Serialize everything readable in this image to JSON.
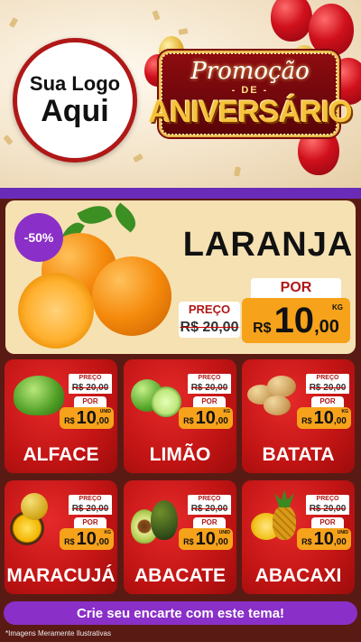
{
  "header": {
    "logo_line1": "Sua Logo",
    "logo_line2": "Aqui",
    "promo_line1": "Promoção",
    "promo_line2": "- DE -",
    "promo_line3": "ANIVERSÁRIO"
  },
  "colors": {
    "accent_purple": "#8a2fc7",
    "card_red": "#c21414",
    "price_orange": "#f7a21b",
    "bg_brown": "#5a1a14"
  },
  "hero": {
    "discount": "-50%",
    "name": "LARANJA",
    "preco_label": "PREÇO",
    "old_price": "R$ 20,00",
    "por_label": "POR",
    "currency": "R$",
    "price_int": "10",
    "price_cents": ",00",
    "unit": "KG"
  },
  "products": [
    {
      "name": "ALFACE",
      "preco_label": "PREÇO",
      "old_price": "R$ 20,00",
      "por_label": "POR",
      "currency": "R$",
      "price_int": "10",
      "price_cents": ",00",
      "unit": "UNID",
      "icon": "lettuce-icon"
    },
    {
      "name": "LIMÃO",
      "preco_label": "PREÇO",
      "old_price": "R$ 20,00",
      "por_label": "POR",
      "currency": "R$",
      "price_int": "10",
      "price_cents": ",00",
      "unit": "KG",
      "icon": "lime-icon"
    },
    {
      "name": "BATATA",
      "preco_label": "PREÇO",
      "old_price": "R$ 20,00",
      "por_label": "POR",
      "currency": "R$",
      "price_int": "10",
      "price_cents": ",00",
      "unit": "KG",
      "icon": "potato-icon"
    },
    {
      "name": "MARACUJÁ",
      "preco_label": "PREÇO",
      "old_price": "R$ 20,00",
      "por_label": "POR",
      "currency": "R$",
      "price_int": "10",
      "price_cents": ",00",
      "unit": "KG",
      "icon": "passion-fruit-icon"
    },
    {
      "name": "ABACATE",
      "preco_label": "PREÇO",
      "old_price": "R$ 20,00",
      "por_label": "POR",
      "currency": "R$",
      "price_int": "10",
      "price_cents": ",00",
      "unit": "UNID",
      "icon": "avocado-icon"
    },
    {
      "name": "ABACAXI",
      "preco_label": "PREÇO",
      "old_price": "R$ 20,00",
      "por_label": "POR",
      "currency": "R$",
      "price_int": "10",
      "price_cents": ",00",
      "unit": "UNID",
      "icon": "pineapple-icon"
    }
  ],
  "cta": "Crie seu encarte com este tema!",
  "disclaimer": "*Imagens Meramente Ilustrativas"
}
